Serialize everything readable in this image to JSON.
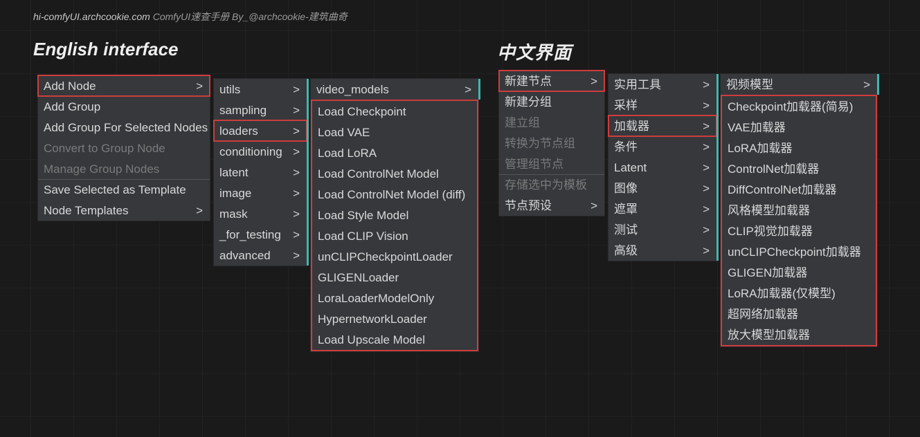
{
  "header": {
    "site": "hi-comfyUI.archcookie.com",
    "rest": " ComfyUI速查手册  By_@archcookie-建筑曲奇"
  },
  "titles": {
    "en": "English interface",
    "cn": "中文界面"
  },
  "en_context": {
    "items": [
      {
        "label": "Add Node",
        "arrow": true,
        "hl": true
      },
      {
        "label": "Add Group",
        "arrow": false
      },
      {
        "label": "Add Group For Selected Nodes",
        "arrow": false
      },
      {
        "label": "Convert to Group Node",
        "arrow": false,
        "disabled": true
      },
      {
        "label": "Manage Group Nodes",
        "arrow": false,
        "disabled": true
      },
      {
        "label": "Save Selected as Template",
        "arrow": false,
        "break": true
      },
      {
        "label": "Node Templates",
        "arrow": true
      }
    ]
  },
  "en_cats": {
    "items": [
      {
        "label": "utils",
        "arrow": true
      },
      {
        "label": "sampling",
        "arrow": true
      },
      {
        "label": "loaders",
        "arrow": true,
        "hl": true
      },
      {
        "label": "conditioning",
        "arrow": true
      },
      {
        "label": "latent",
        "arrow": true
      },
      {
        "label": "image",
        "arrow": true
      },
      {
        "label": "mask",
        "arrow": true
      },
      {
        "label": "_for_testing",
        "arrow": true
      },
      {
        "label": "advanced",
        "arrow": true
      }
    ]
  },
  "en_third": {
    "header": {
      "label": "video_models",
      "arrow": true
    },
    "items": [
      {
        "label": "Load Checkpoint"
      },
      {
        "label": "Load VAE"
      },
      {
        "label": "Load LoRA"
      },
      {
        "label": "Load ControlNet Model"
      },
      {
        "label": "Load ControlNet Model (diff)"
      },
      {
        "label": "Load Style Model"
      },
      {
        "label": "Load CLIP Vision"
      },
      {
        "label": "unCLIPCheckpointLoader"
      },
      {
        "label": "GLIGENLoader"
      },
      {
        "label": "LoraLoaderModelOnly"
      },
      {
        "label": "HypernetworkLoader"
      },
      {
        "label": "Load Upscale Model"
      }
    ]
  },
  "cn_context": {
    "items": [
      {
        "label": "新建节点",
        "arrow": true,
        "hl": true
      },
      {
        "label": "新建分组",
        "arrow": false
      },
      {
        "label": "建立组",
        "arrow": false,
        "disabled": true
      },
      {
        "label": "转换为节点组",
        "arrow": false,
        "disabled": true
      },
      {
        "label": "管理组节点",
        "arrow": false,
        "disabled": true
      },
      {
        "label": "存储选中为模板",
        "arrow": false,
        "disabled": true,
        "break": true
      },
      {
        "label": "节点预设",
        "arrow": true
      }
    ]
  },
  "cn_cats": {
    "items": [
      {
        "label": "实用工具",
        "arrow": true
      },
      {
        "label": "采样",
        "arrow": true
      },
      {
        "label": "加载器",
        "arrow": true,
        "hl": true
      },
      {
        "label": "条件",
        "arrow": true
      },
      {
        "label": "Latent",
        "arrow": true
      },
      {
        "label": "图像",
        "arrow": true
      },
      {
        "label": "遮罩",
        "arrow": true
      },
      {
        "label": "测试",
        "arrow": true
      },
      {
        "label": "高级",
        "arrow": true
      }
    ]
  },
  "cn_third": {
    "header": {
      "label": "视频模型",
      "arrow": true
    },
    "items": [
      {
        "label": "Checkpoint加载器(简易)"
      },
      {
        "label": "VAE加载器"
      },
      {
        "label": "LoRA加载器"
      },
      {
        "label": "ControlNet加载器"
      },
      {
        "label": "DiffControlNet加载器"
      },
      {
        "label": "风格模型加载器"
      },
      {
        "label": "CLIP视觉加载器"
      },
      {
        "label": "unCLIPCheckpoint加载器"
      },
      {
        "label": "GLIGEN加载器"
      },
      {
        "label": "LoRA加载器(仅模型)"
      },
      {
        "label": "超网络加载器"
      },
      {
        "label": "放大模型加载器"
      }
    ]
  },
  "chevron": ">"
}
